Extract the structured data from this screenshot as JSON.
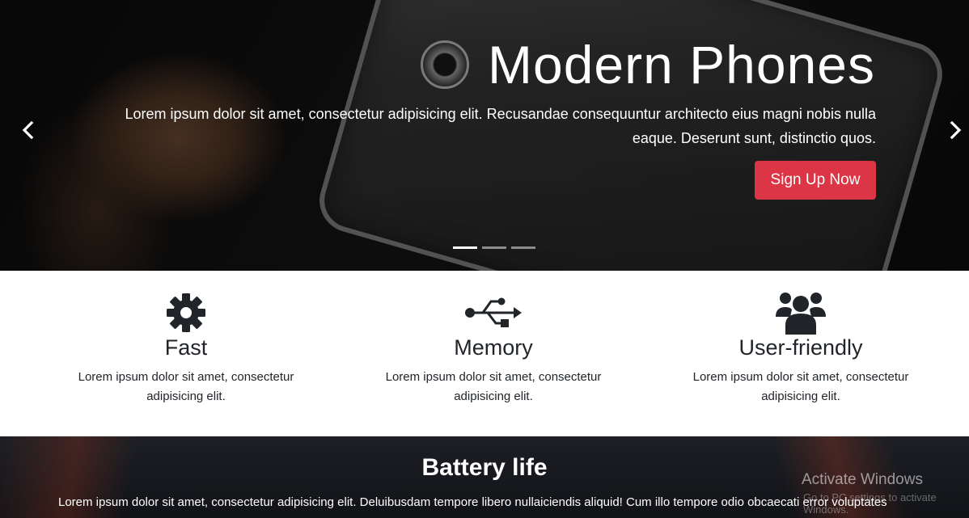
{
  "hero": {
    "title": "Modern Phones",
    "text": "Lorem ipsum dolor sit amet, consectetur adipisicing elit. Recusandae consequuntur architecto eius magni nobis nulla eaque. Deserunt sunt, distinctio quos.",
    "cta_label": "Sign Up Now",
    "cta_color": "#dc3545",
    "prev_icon": "chevron-left-icon",
    "next_icon": "chevron-right-icon",
    "slides_total": 3,
    "active_slide": 1
  },
  "features": [
    {
      "icon": "gear-icon",
      "title": "Fast",
      "text": "Lorem ipsum dolor sit amet, consectetur adipisicing elit."
    },
    {
      "icon": "usb-icon",
      "title": "Memory",
      "text": "Lorem ipsum dolor sit amet, consectetur adipisicing elit."
    },
    {
      "icon": "users-icon",
      "title": "User-friendly",
      "text": "Lorem ipsum dolor sit amet, consectetur adipisicing elit."
    }
  ],
  "battery": {
    "title": "Battery life",
    "text": "Lorem ipsum dolor sit amet, consectetur adipisicing elit. Deluibusdam tempore libero nullaiciendis aliquid! Cum illo tempore odio obcaecati error voluptates"
  },
  "watermark": {
    "title": "Activate Windows",
    "subtitle": "Go to PC settings to activate Windows."
  }
}
